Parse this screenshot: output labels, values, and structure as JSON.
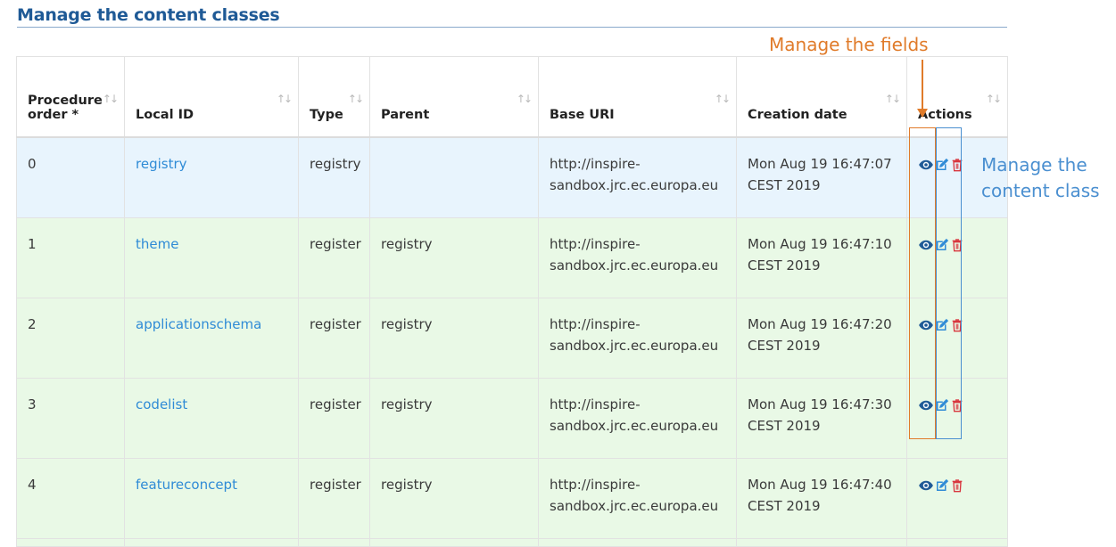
{
  "page": {
    "title": "Manage the content classes"
  },
  "table": {
    "headers": {
      "procedure_order": "Procedure order *",
      "local_id": "Local ID",
      "type": "Type",
      "parent": "Parent",
      "base_uri": "Base URI",
      "creation_date": "Creation date",
      "actions": "Actions"
    },
    "rows": [
      {
        "order": "0",
        "local_id": "registry",
        "type": "registry",
        "parent": "",
        "base_uri": "http://inspire-sandbox.jrc.ec.europa.eu",
        "creation_date": "Mon Aug 19 16:47:07 CEST 2019"
      },
      {
        "order": "1",
        "local_id": "theme",
        "type": "register",
        "parent": "registry",
        "base_uri": "http://inspire-sandbox.jrc.ec.europa.eu",
        "creation_date": "Mon Aug 19 16:47:10 CEST 2019"
      },
      {
        "order": "2",
        "local_id": "applicationschema",
        "type": "register",
        "parent": "registry",
        "base_uri": "http://inspire-sandbox.jrc.ec.europa.eu",
        "creation_date": "Mon Aug 19 16:47:20 CEST 2019"
      },
      {
        "order": "3",
        "local_id": "codelist",
        "type": "register",
        "parent": "registry",
        "base_uri": "http://inspire-sandbox.jrc.ec.europa.eu",
        "creation_date": "Mon Aug 19 16:47:30 CEST 2019"
      },
      {
        "order": "4",
        "local_id": "featureconcept",
        "type": "register",
        "parent": "registry",
        "base_uri": "http://inspire-sandbox.jrc.ec.europa.eu",
        "creation_date": "Mon Aug 19 16:47:40 CEST 2019"
      }
    ]
  },
  "annotations": {
    "manage_fields": "Manage the fields",
    "manage_content_class": "Manage the content class"
  },
  "colors": {
    "title": "#1f5a96",
    "link": "#2f8bd6",
    "row_selected": "#e8f4fd",
    "row": "#e9f9e6",
    "annotation_orange": "#e07b2a",
    "annotation_blue": "#4a8fd0",
    "delete": "#d9363e"
  },
  "icons": {
    "view": "eye-icon",
    "edit": "edit-icon",
    "delete": "trash-icon",
    "sort": "sort-icon"
  }
}
